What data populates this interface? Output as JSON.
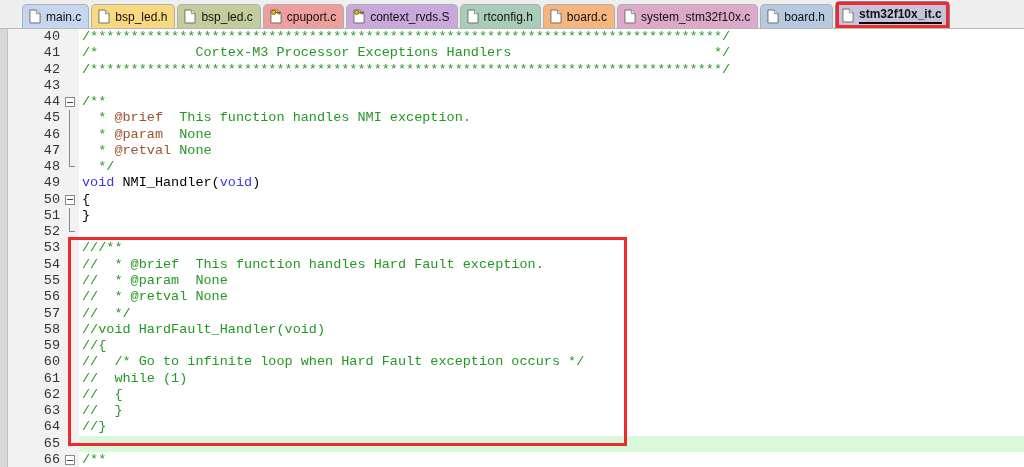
{
  "tabs": [
    {
      "label": "main.c",
      "kind": "plain",
      "color": "#c6d6ef",
      "selected": false,
      "highlighted": false
    },
    {
      "label": "bsp_led.h",
      "kind": "plain",
      "color": "#f8d97f",
      "selected": false,
      "highlighted": false
    },
    {
      "label": "bsp_led.c",
      "kind": "plain",
      "color": "#c3cc9c",
      "selected": false,
      "highlighted": false
    },
    {
      "label": "cpuport.c",
      "kind": "keyed",
      "color": "#ee9f9b",
      "selected": false,
      "highlighted": false
    },
    {
      "label": "context_rvds.S",
      "kind": "keyed",
      "color": "#c9a8dd",
      "selected": false,
      "highlighted": false
    },
    {
      "label": "rtconfig.h",
      "kind": "plain",
      "color": "#a8ccb8",
      "selected": false,
      "highlighted": false
    },
    {
      "label": "board.c",
      "kind": "plain",
      "color": "#f6b57f",
      "selected": false,
      "highlighted": false
    },
    {
      "label": "system_stm32f10x.c",
      "kind": "plain",
      "color": "#dcaac8",
      "selected": false,
      "highlighted": false
    },
    {
      "label": "board.h",
      "kind": "plain",
      "color": "#b6cadf",
      "selected": false,
      "highlighted": false
    },
    {
      "label": "stm32f10x_it.c",
      "kind": "plain",
      "color": "#c4c4dc",
      "selected": true,
      "highlighted": true
    }
  ],
  "sections": [
    {
      "framed": false,
      "lines": [
        {
          "number": "40",
          "kind": "plain",
          "current": false,
          "spans": [
            {
              "kind": "comment",
              "text": "/******************************************************************************/"
            }
          ]
        },
        {
          "number": "41",
          "kind": "plain",
          "current": false,
          "spans": [
            {
              "kind": "comment",
              "text": "/*            Cortex-M3 Processor Exceptions Handlers                         */"
            }
          ]
        },
        {
          "number": "42",
          "kind": "plain",
          "current": false,
          "spans": [
            {
              "kind": "comment",
              "text": "/******************************************************************************/"
            }
          ]
        },
        {
          "number": "43",
          "kind": "plain",
          "current": false
        },
        {
          "number": "44",
          "kind": "fold_start",
          "current": false,
          "spans": [
            {
              "kind": "comment",
              "text": "/**"
            }
          ]
        },
        {
          "number": "45",
          "kind": "fold_inside",
          "current": false,
          "spans": [
            {
              "kind": "comment",
              "text": "  * "
            },
            {
              "kind": "tag",
              "text": "@brief"
            },
            {
              "kind": "comment",
              "text": "  This function handles NMI exception."
            }
          ]
        },
        {
          "number": "46",
          "kind": "fold_inside",
          "current": false,
          "spans": [
            {
              "kind": "comment",
              "text": "  * "
            },
            {
              "kind": "tag",
              "text": "@param"
            },
            {
              "kind": "comment",
              "text": "  None"
            }
          ]
        },
        {
          "number": "47",
          "kind": "fold_inside",
          "current": false,
          "spans": [
            {
              "kind": "comment",
              "text": "  * "
            },
            {
              "kind": "tag",
              "text": "@retval"
            },
            {
              "kind": "comment",
              "text": " None"
            }
          ]
        },
        {
          "number": "48",
          "kind": "fold_end",
          "current": false,
          "spans": [
            {
              "kind": "comment",
              "text": "  */"
            }
          ]
        },
        {
          "number": "49",
          "kind": "plain",
          "current": false,
          "spans": [
            {
              "kind": "keyword",
              "text": "void"
            },
            {
              "kind": "plain",
              "text": " NMI_Handler("
            },
            {
              "kind": "keyword",
              "text": "void"
            },
            {
              "kind": "plain",
              "text": ")"
            }
          ]
        },
        {
          "number": "50",
          "kind": "fold_start",
          "current": false,
          "spans": [
            {
              "kind": "plain",
              "text": "{"
            }
          ]
        },
        {
          "number": "51",
          "kind": "fold_inside",
          "current": false,
          "spans": [
            {
              "kind": "plain",
              "text": "}"
            }
          ]
        },
        {
          "number": "52",
          "kind": "fold_end",
          "current": false
        }
      ]
    },
    {
      "framed": true,
      "lines": [
        {
          "number": "53",
          "kind": "plain",
          "current": false,
          "spans": [
            {
              "kind": "comment",
              "text": "///**"
            }
          ]
        },
        {
          "number": "54",
          "kind": "plain",
          "current": false,
          "spans": [
            {
              "kind": "comment",
              "text": "//  * @brief  This function handles Hard Fault exception."
            }
          ]
        },
        {
          "number": "55",
          "kind": "plain",
          "current": false,
          "spans": [
            {
              "kind": "comment",
              "text": "//  * @param  None"
            }
          ]
        },
        {
          "number": "56",
          "kind": "plain",
          "current": false,
          "spans": [
            {
              "kind": "comment",
              "text": "//  * @retval None"
            }
          ]
        },
        {
          "number": "57",
          "kind": "plain",
          "current": false,
          "spans": [
            {
              "kind": "comment",
              "text": "//  */"
            }
          ]
        },
        {
          "number": "58",
          "kind": "plain",
          "current": false,
          "spans": [
            {
              "kind": "comment",
              "text": "//void HardFault_Handler(void)"
            }
          ]
        },
        {
          "number": "59",
          "kind": "plain",
          "current": false,
          "spans": [
            {
              "kind": "comment",
              "text": "//{"
            }
          ]
        },
        {
          "number": "60",
          "kind": "plain",
          "current": false,
          "spans": [
            {
              "kind": "comment",
              "text": "//  /* Go to infinite loop when Hard Fault exception occurs */"
            }
          ]
        },
        {
          "number": "61",
          "kind": "plain",
          "current": false,
          "spans": [
            {
              "kind": "comment",
              "text": "//  while (1)"
            }
          ]
        },
        {
          "number": "62",
          "kind": "plain",
          "current": false,
          "spans": [
            {
              "kind": "comment",
              "text": "//  {"
            }
          ]
        },
        {
          "number": "63",
          "kind": "plain",
          "current": false,
          "spans": [
            {
              "kind": "comment",
              "text": "//  }"
            }
          ]
        },
        {
          "number": "64",
          "kind": "plain",
          "current": false,
          "spans": [
            {
              "kind": "comment",
              "text": "//}"
            }
          ]
        }
      ]
    },
    {
      "framed": false,
      "lines": [
        {
          "number": "65",
          "kind": "plain",
          "current": true
        },
        {
          "number": "66",
          "kind": "fold_start",
          "current": false,
          "spans": [
            {
              "kind": "comment",
              "text": "/**"
            }
          ]
        }
      ]
    }
  ]
}
